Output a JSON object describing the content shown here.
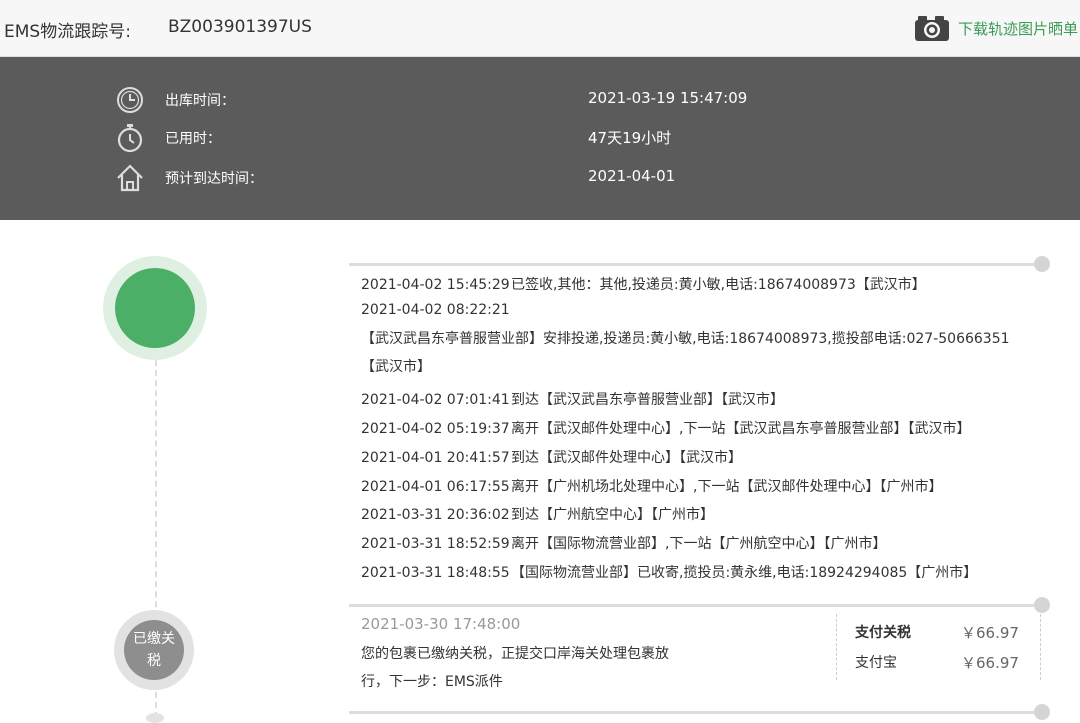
{
  "header": {
    "tracking_label": "EMS物流跟踪号:",
    "tracking_number": "BZ003901397US",
    "download_text": "下载轨迹图片晒单"
  },
  "info": {
    "rows": [
      {
        "icon": "clock-icon",
        "label": "出库时间：",
        "value": "2021-03-19 15:47:09"
      },
      {
        "icon": "stopwatch-icon",
        "label": "已用时：",
        "value": "47天19小时"
      },
      {
        "icon": "home-icon",
        "label": "预计到达时间：",
        "value": "2021-04-01"
      }
    ]
  },
  "events": [
    {
      "time": "2021-04-02 15:45:29",
      "text": "已签收,其他：其他,投递员:黄小敏,电话:18674008973【武汉市】"
    },
    {
      "time": "2021-04-02 08:22:21",
      "text": "【武汉武昌东亭普服营业部】安排投递,投递员:黄小敏,电话:18674008973,揽投部电话:027-50666351【武汉市】"
    },
    {
      "time": "2021-04-02 07:01:41",
      "text": "到达【武汉武昌东亭普服营业部】【武汉市】"
    },
    {
      "time": "2021-04-02 05:19:37",
      "text": "离开【武汉邮件处理中心】,下一站【武汉武昌东亭普服营业部】【武汉市】"
    },
    {
      "time": "2021-04-01 20:41:57",
      "text": "到达【武汉邮件处理中心】【武汉市】"
    },
    {
      "time": "2021-04-01 06:17:55",
      "text": "离开【广州机场北处理中心】,下一站【武汉邮件处理中心】【广州市】"
    },
    {
      "time": "2021-03-31 20:36:02",
      "text": "到达【广州航空中心】【广州市】"
    },
    {
      "time": "2021-03-31 18:52:59",
      "text": "离开【国际物流营业部】,下一站【广州航空中心】【广州市】"
    },
    {
      "time": "2021-03-31 18:48:55",
      "text": "【国际物流营业部】已收寄,揽投员:黄永维,电话:18924294085【广州市】"
    }
  ],
  "tax": {
    "badge_line1": "已缴关",
    "badge_line2": "税",
    "time": "2021-03-30 17:48:00",
    "desc": "您的包裹已缴纳关税，正提交口岸海关处理包裹放行，下一步：EMS派件",
    "payments": [
      {
        "label": "支付关税",
        "amount": "￥66.97"
      },
      {
        "label": "支付宝",
        "amount": "￥66.97"
      }
    ]
  },
  "colors": {
    "green": "#4caf68",
    "panel": "#5b5b5b",
    "link": "#3c9b57"
  }
}
